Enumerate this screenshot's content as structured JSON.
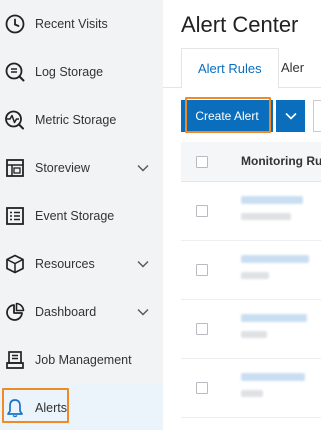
{
  "sidebar": {
    "items": [
      {
        "label": "Recent Visits",
        "icon": "clock-icon"
      },
      {
        "label": "Log Storage",
        "icon": "log-search-icon"
      },
      {
        "label": "Metric Storage",
        "icon": "metric-icon"
      },
      {
        "label": "Storeview",
        "icon": "storeview-icon",
        "expandable": true
      },
      {
        "label": "Event Storage",
        "icon": "event-list-icon"
      },
      {
        "label": "Resources",
        "icon": "cube-icon",
        "expandable": true
      },
      {
        "label": "Dashboard",
        "icon": "pie-chart-icon",
        "expandable": true
      },
      {
        "label": "Job Management",
        "icon": "job-icon"
      },
      {
        "label": "Alerts",
        "icon": "bell-icon",
        "active": true
      }
    ]
  },
  "main": {
    "title": "Alert Center",
    "tabs": [
      {
        "label": "Alert Rules",
        "active": true
      },
      {
        "label": "Aler"
      }
    ],
    "create_button": "Create Alert",
    "table": {
      "columns": [
        "Monitoring Ru"
      ]
    }
  },
  "colors": {
    "accent": "#0a6ebd",
    "highlight": "#f08a24",
    "sidebar_bg": "#f2f3f5",
    "active_bg": "#ebf3fb"
  }
}
